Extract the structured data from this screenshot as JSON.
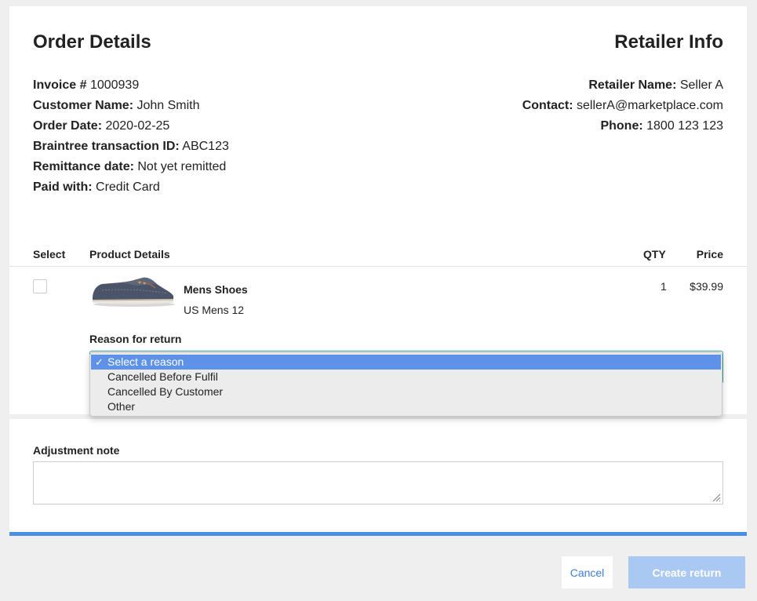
{
  "order": {
    "title": "Order Details",
    "fields": [
      {
        "label": "Invoice #",
        "value": "1000939"
      },
      {
        "label": "Customer Name:",
        "value": "John Smith"
      },
      {
        "label": "Order Date:",
        "value": "2020-02-25"
      },
      {
        "label": "Braintree transaction ID:",
        "value": "ABC123"
      },
      {
        "label": "Remittance date:",
        "value": "Not yet remitted"
      },
      {
        "label": "Paid with:",
        "value": "Credit Card"
      }
    ]
  },
  "retailer": {
    "title": "Retailer Info",
    "fields": [
      {
        "label": "Retailer Name:",
        "value": "Seller A"
      },
      {
        "label": "Contact:",
        "value": "sellerA@marketplace.com"
      },
      {
        "label": "Phone:",
        "value": "1800 123 123"
      }
    ]
  },
  "table": {
    "headers": {
      "select": "Select",
      "product": "Product Details",
      "qty": "QTY",
      "price": "Price"
    },
    "rows": [
      {
        "name": "Mens Shoes",
        "variant": "US Mens 12",
        "qty": "1",
        "price": "$39.99",
        "checked": false,
        "image_icon": "boat-shoe-image"
      }
    ]
  },
  "reason": {
    "label": "Reason for return",
    "check_mark": "✓",
    "options": [
      "Select a reason",
      "Cancelled Before Fulfil",
      "Cancelled By Customer",
      "Other"
    ],
    "selected": "Select a reason"
  },
  "adjustment": {
    "label": "Adjustment note",
    "value": ""
  },
  "actions": {
    "cancel": "Cancel",
    "create": "Create return"
  },
  "colors": {
    "accent": "#4a90e2",
    "selected_option": "#5e92e8",
    "create_button_disabled": "#a9c9f3",
    "link": "#3d7fd4"
  }
}
